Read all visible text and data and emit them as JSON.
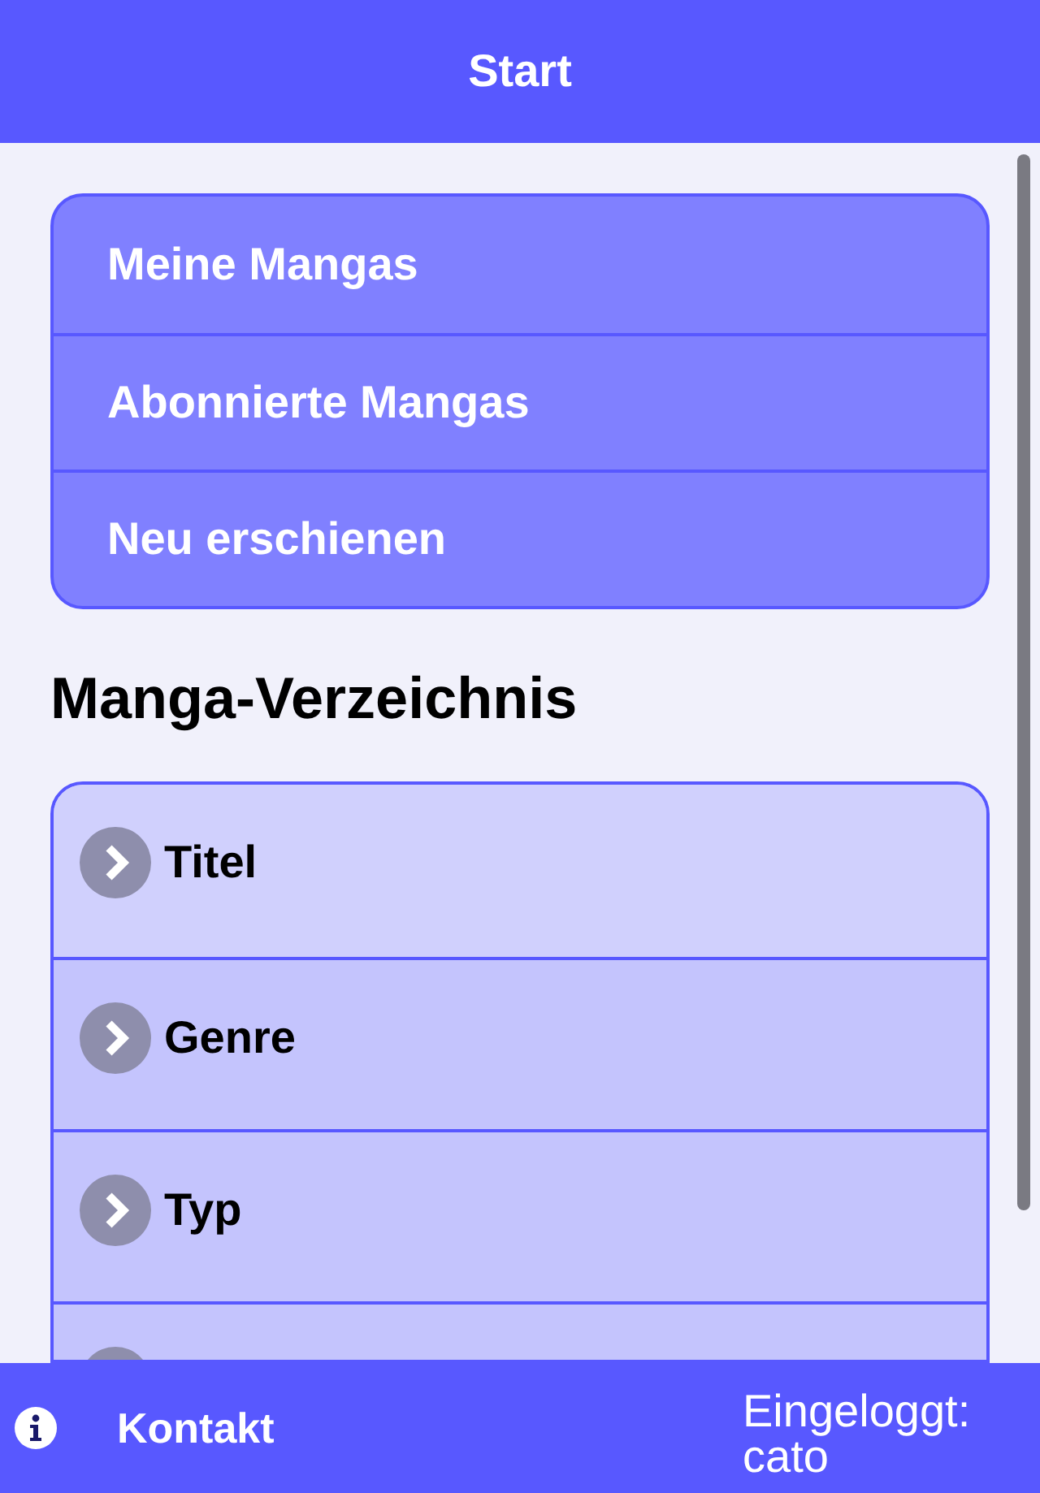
{
  "header": {
    "title": "Start"
  },
  "menu": [
    {
      "label": "Meine Mangas"
    },
    {
      "label": "Abonnierte Mangas"
    },
    {
      "label": "Neu erschienen"
    }
  ],
  "directory": {
    "title": "Manga-Verzeichnis",
    "items": [
      {
        "kind": "link",
        "label": "Titel"
      },
      {
        "kind": "link",
        "label": "Genre"
      },
      {
        "kind": "link",
        "label": "Typ"
      },
      {
        "kind": "cut"
      }
    ]
  },
  "footer": {
    "contact": "Kontakt",
    "login": "Eingeloggt: cato"
  }
}
